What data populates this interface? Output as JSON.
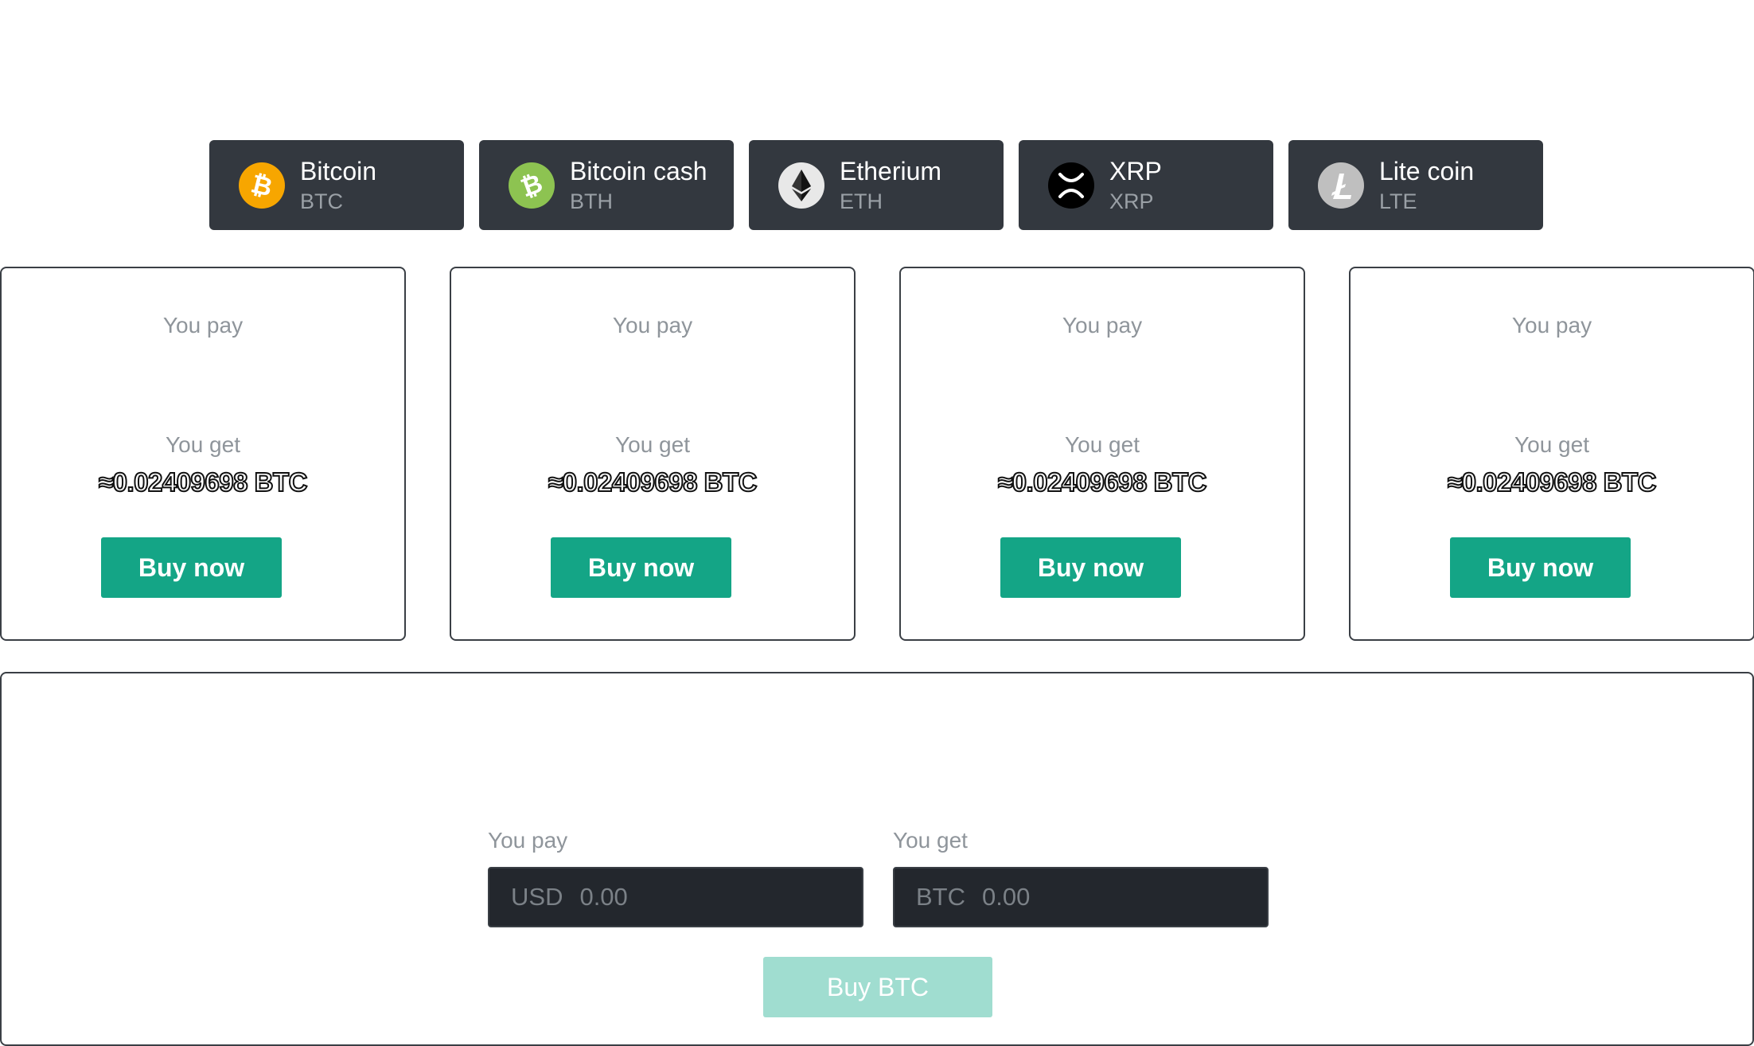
{
  "coins": [
    {
      "name": "Bitcoin",
      "symbol": "BTC",
      "icon": "bitcoin-icon",
      "color": "#f7a600"
    },
    {
      "name": "Bitcoin cash",
      "symbol": "BTH",
      "icon": "bitcoin-cash-icon",
      "color": "#8dc351"
    },
    {
      "name": "Etherium",
      "symbol": "ETH",
      "icon": "ethereum-icon",
      "color": "#e8e8e8"
    },
    {
      "name": "XRP",
      "symbol": "XRP",
      "icon": "xrp-icon",
      "color": "#000000"
    },
    {
      "name": "Lite coin",
      "symbol": "LTE",
      "icon": "litecoin-icon",
      "color": "#bfbfbf"
    }
  ],
  "offers": [
    {
      "pay_label": "You pay",
      "get_label": "You get",
      "amount": "≈0.02409698 BTC",
      "button": "Buy now"
    },
    {
      "pay_label": "You pay",
      "get_label": "You get",
      "amount": "≈0.02409698 BTC",
      "button": "Buy now"
    },
    {
      "pay_label": "You pay",
      "get_label": "You get",
      "amount": "≈0.02409698 BTC",
      "button": "Buy now"
    },
    {
      "pay_label": "You pay",
      "get_label": "You get",
      "amount": "≈0.02409698 BTC",
      "button": "Buy now"
    }
  ],
  "exchange": {
    "pay_label": "You pay",
    "pay_currency": "USD",
    "pay_placeholder": "0.00",
    "get_label": "You get",
    "get_currency": "BTC",
    "get_placeholder": "0.00",
    "button": "Buy BTC"
  },
  "colors": {
    "tab_bg": "#33383f",
    "accent": "#14a586",
    "accent_disabled": "#a0ddd0",
    "input_bg": "#23272d"
  }
}
